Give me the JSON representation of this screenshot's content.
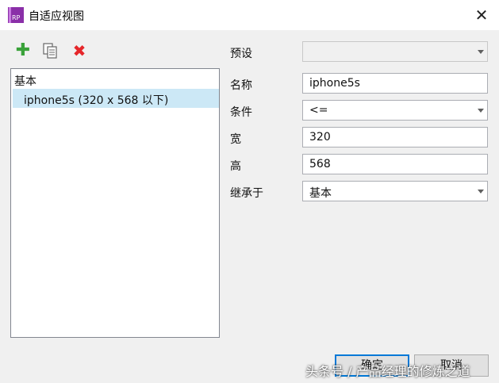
{
  "window": {
    "title": "自适应视图",
    "close_glyph": "✕"
  },
  "app_icon": {
    "text": "RP",
    "color": "#8a2fa8"
  },
  "toolbar": {
    "add_glyph": "✚",
    "delete_glyph": "✖"
  },
  "views": {
    "root": "基本",
    "children": [
      "iphone5s (320 x 568 以下)"
    ],
    "selected_color": "#cce8f6"
  },
  "form": {
    "preset": {
      "label": "预设",
      "value": ""
    },
    "name": {
      "label": "名称",
      "value": "iphone5s"
    },
    "condition": {
      "label": "条件",
      "value": "<="
    },
    "width": {
      "label": "宽",
      "value": "320"
    },
    "height": {
      "label": "高",
      "value": "568"
    },
    "inherit": {
      "label": "继承于",
      "value": "基本"
    }
  },
  "buttons": {
    "ok": "确定",
    "cancel": "取消"
  },
  "watermark": "头条号 / 产品经理的修炼之道"
}
